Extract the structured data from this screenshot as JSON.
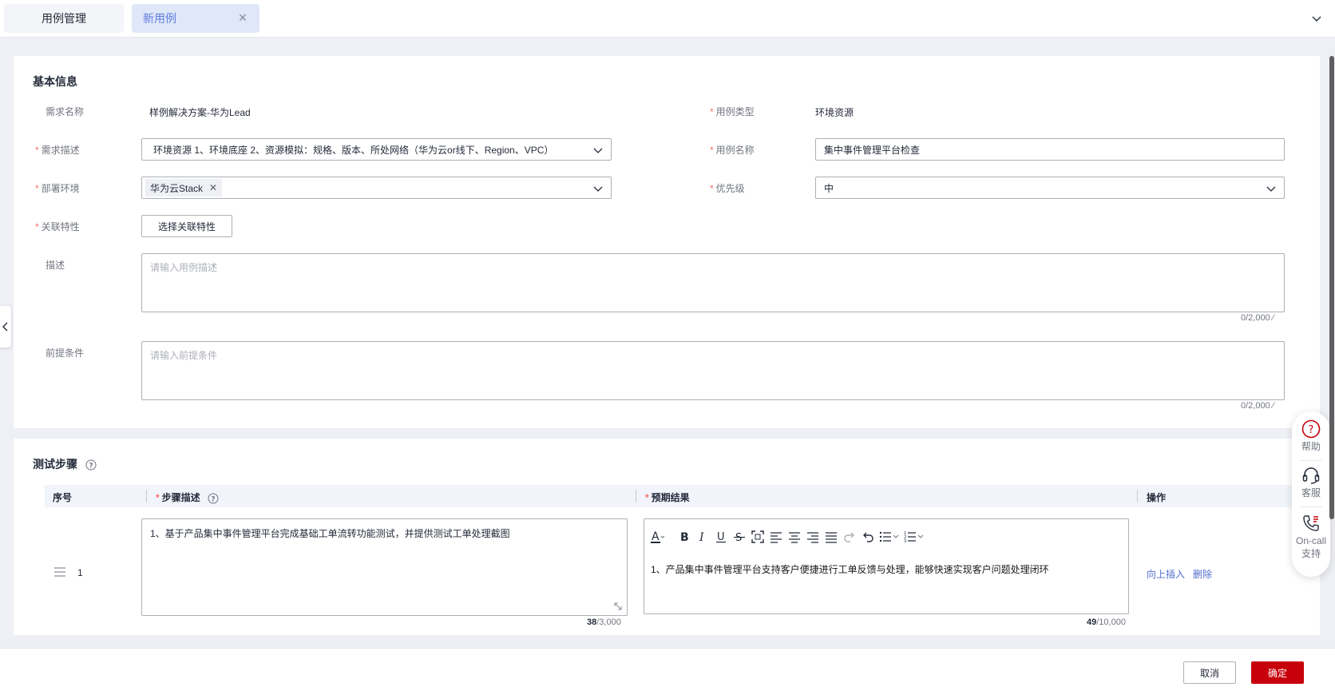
{
  "tabs": [
    {
      "label": "用例管理",
      "active": false
    },
    {
      "label": "新用例",
      "active": true
    }
  ],
  "basic": {
    "title": "基本信息",
    "requirement_name": {
      "label": "需求名称",
      "value": "样例解决方案-华为Lead"
    },
    "case_type": {
      "label": "用例类型",
      "value": "环境资源"
    },
    "requirement_desc": {
      "label": "需求描述",
      "value": "环境资源 1、环境底座 2、资源模拟：规格、版本、所处网络（华为云or线下、Region、VPC）"
    },
    "case_name": {
      "label": "用例名称",
      "value": "集中事件管理平台检查"
    },
    "deploy_env": {
      "label": "部署环境",
      "chip": "华为云Stack"
    },
    "priority": {
      "label": "优先级",
      "value": "中"
    },
    "related_feature": {
      "label": "关联特性",
      "button": "选择关联特性"
    },
    "description": {
      "label": "描述",
      "placeholder": "请输入用例描述",
      "counter": "0/2,000"
    },
    "precondition": {
      "label": "前提条件",
      "placeholder": "请输入前提条件",
      "counter": "0/2,000"
    }
  },
  "steps": {
    "title": "测试步骤",
    "columns": {
      "index": "序号",
      "desc": "步骤描述",
      "expected": "预期结果",
      "action": "操作"
    },
    "rows": [
      {
        "index": "1",
        "desc": "1、基于产品集中事件管理平台完成基础工单流转功能测试，并提供测试工单处理截图",
        "desc_count": "38",
        "desc_max": "/3,000",
        "expected": "1、产品集中事件管理平台支持客户便捷进行工单反馈与处理，能够快速实现客户问题处理闭环",
        "expected_count": "49",
        "expected_max": "/10,000",
        "insert_above": "向上插入",
        "delete": "删除"
      }
    ]
  },
  "float_help": {
    "help": "帮助",
    "service": "客服",
    "oncall": "On-call",
    "oncall2": "支持"
  },
  "footer": {
    "cancel": "取消",
    "confirm": "确定"
  },
  "colors": {
    "brand_red": "#c7000b",
    "link_blue": "#526ecc",
    "required_red": "#f66f6a",
    "tab_active": "#5e7ce0"
  }
}
